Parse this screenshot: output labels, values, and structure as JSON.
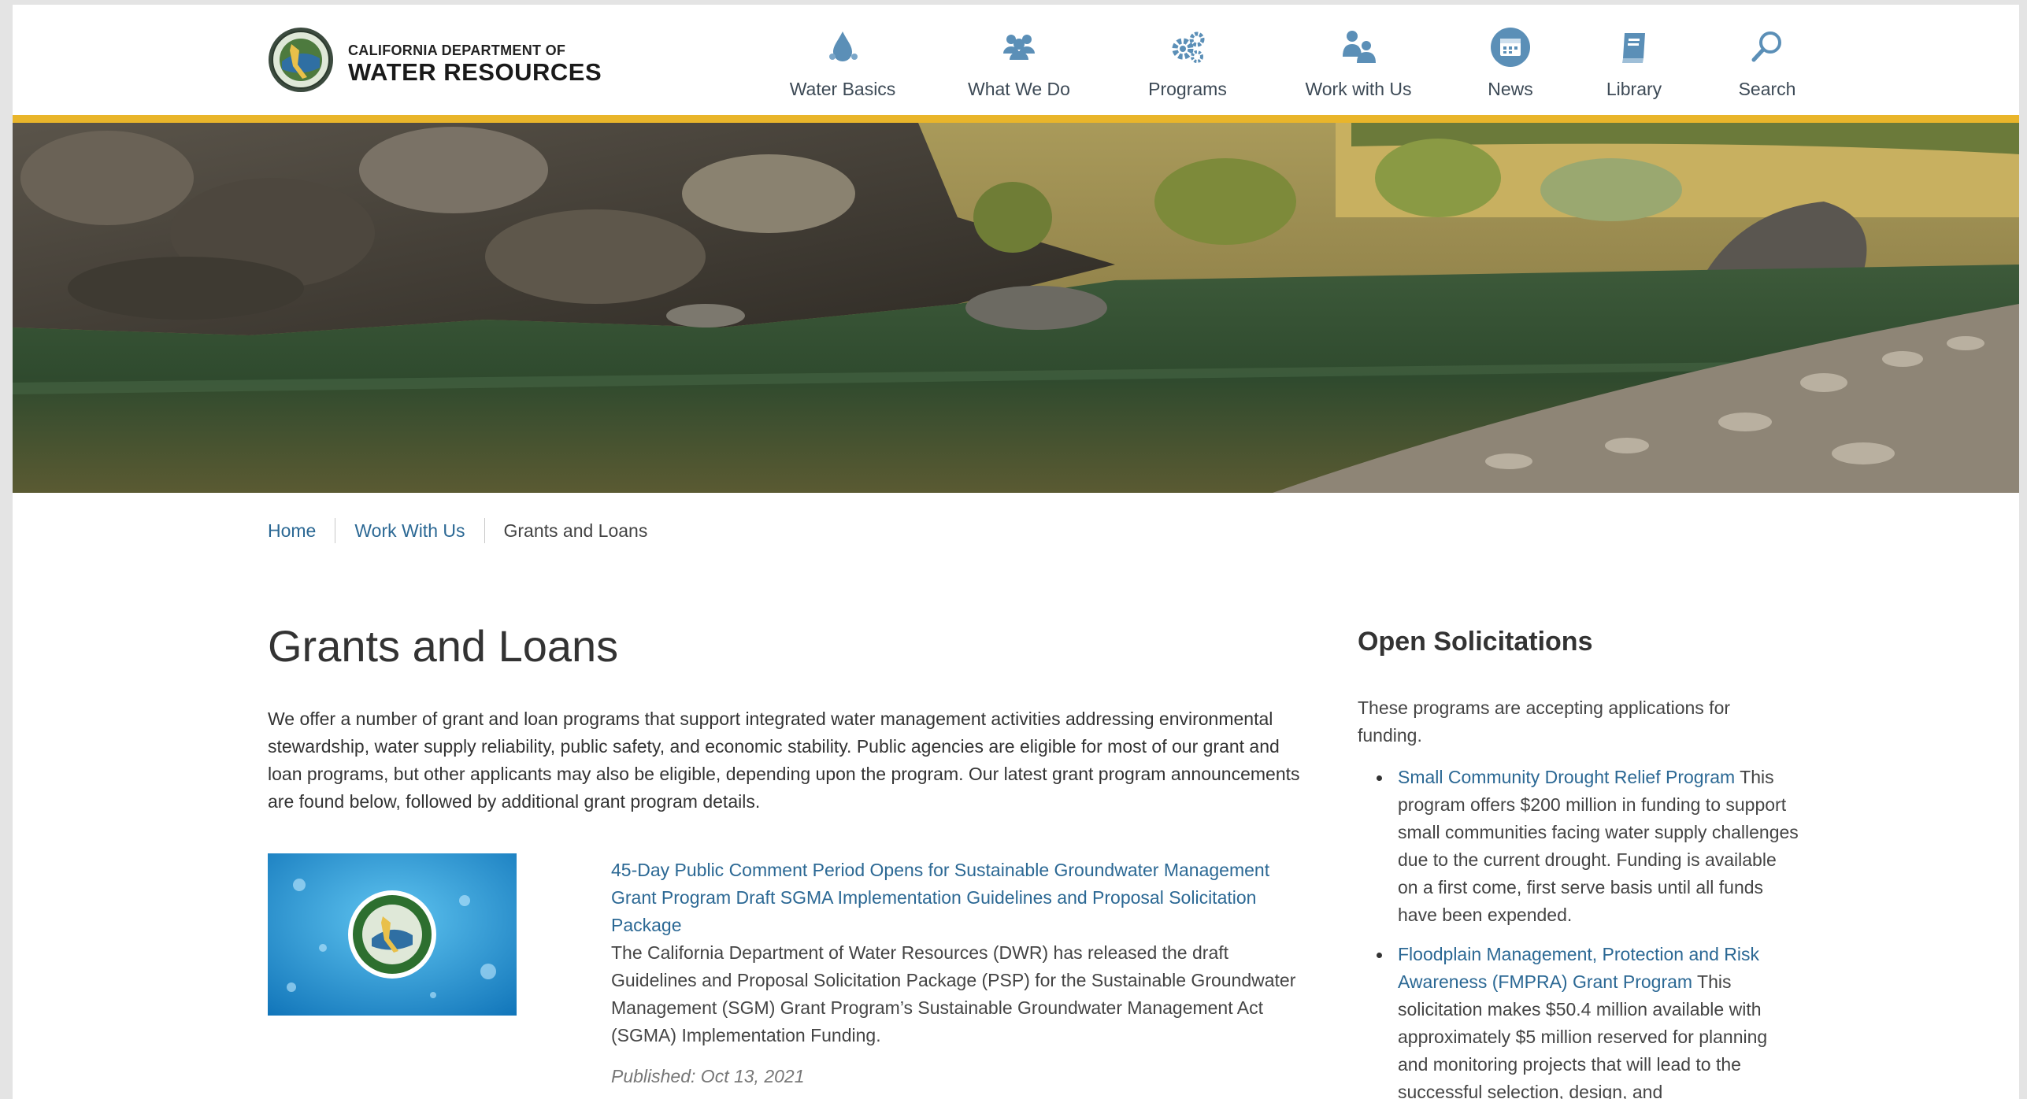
{
  "header": {
    "logo_small": "CALIFORNIA DEPARTMENT OF",
    "logo_big": "WATER RESOURCES",
    "nav": [
      {
        "label": "Water Basics",
        "icon": "water-drop-icon"
      },
      {
        "label": "What We Do",
        "icon": "people-group-icon"
      },
      {
        "label": "Programs",
        "icon": "gears-icon"
      },
      {
        "label": "Work with Us",
        "icon": "handshake-people-icon"
      },
      {
        "label": "News",
        "icon": "calendar-icon"
      },
      {
        "label": "Library",
        "icon": "book-icon"
      },
      {
        "label": "Search",
        "icon": "search-icon"
      }
    ],
    "accent_color": "#e9b52a",
    "icon_color": "#5b8fb7"
  },
  "breadcrumb": {
    "home": "Home",
    "parent": "Work With Us",
    "current": "Grants and Loans"
  },
  "main": {
    "title": "Grants and Loans",
    "intro": "We offer a number of grant and loan programs that support integrated water management activities addressing environmental stewardship, water supply reliability, public safety, and economic stability. Public agencies are eligible for most of our grant and loan programs, but other applicants may also be eligible, depending upon the program. Our latest grant program announcements are found below, followed by additional grant program details.",
    "news": {
      "title": "45-Day Public Comment Period Opens for Sustainable Groundwater Management Grant Program Draft SGMA Implementation Guidelines and Proposal Solicitation Package",
      "body": "The California Department of Water Resources (DWR) has released the draft Guidelines and Proposal Solicitation Package (PSP) for the Sustainable Groundwater Management (SGM) Grant Program’s Sustainable Groundwater Management Act (SGMA) Implementation Funding.",
      "date": "Published: Oct 13, 2021"
    }
  },
  "sidebar": {
    "title": "Open Solicitations",
    "intro": "These programs are accepting applications for funding.",
    "items": [
      {
        "link": "Small Community Drought Relief Program",
        "text": " This program offers $200 million in funding to support small communities facing water supply challenges due to the current drought. Funding is available on a first come, first serve basis until all funds have been expended."
      },
      {
        "link": "Floodplain Management, Protection and Risk Awareness (FMPRA) Grant Program",
        "text": " This solicitation makes $50.4 million available with approximately $5 million reserved for planning and monitoring projects that will lead to the successful selection, design, and"
      }
    ]
  },
  "colors": {
    "link": "#2b6894",
    "text": "#333333"
  }
}
